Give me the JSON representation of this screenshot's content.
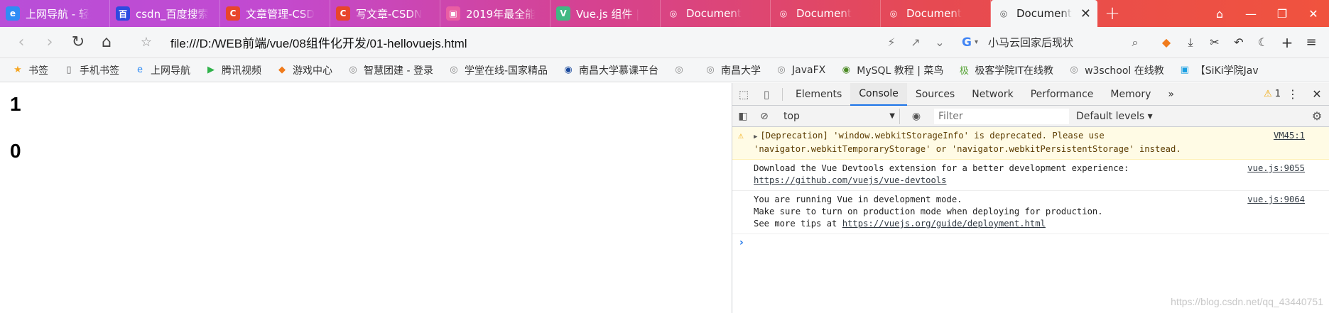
{
  "tabs": [
    {
      "title": "上网导航 - 轻",
      "icon": "e",
      "color": "#2f8cf5"
    },
    {
      "title": "csdn_百度搜索",
      "icon": "百",
      "color": "#2e4ae0"
    },
    {
      "title": "文章管理-CSD",
      "icon": "C",
      "color": "#e8452c"
    },
    {
      "title": "写文章-CSDN",
      "icon": "C",
      "color": "#e8452c"
    },
    {
      "title": "2019年最全能",
      "icon": "▣",
      "color": "#e95ea3"
    },
    {
      "title": "Vue.js 组件 |",
      "icon": "V",
      "color": "#41b883"
    },
    {
      "title": "Document",
      "icon": "◎",
      "color": "transparent"
    },
    {
      "title": "Document",
      "icon": "◎",
      "color": "transparent"
    },
    {
      "title": "Document",
      "icon": "◎",
      "color": "transparent"
    }
  ],
  "active_tab": {
    "title": "Document",
    "icon": "◎",
    "close": "✕"
  },
  "new_tab": "+",
  "window_controls": [
    "⌂",
    "—",
    "❐",
    "✕"
  ],
  "address": {
    "url": "file:///D:/WEB前端/vue/08组件化开发/01-hellovuejs.html",
    "search_text": "小马云回家后现状",
    "search_engine": "G"
  },
  "bookmarks": [
    {
      "label": "书签",
      "icon": "★",
      "color": "#f5a623"
    },
    {
      "label": "手机书签",
      "icon": "▯",
      "color": "#666"
    },
    {
      "label": "上网导航",
      "icon": "e",
      "color": "#2f8cf5"
    },
    {
      "label": "腾讯视频",
      "icon": "▶",
      "color": "#2fb24a"
    },
    {
      "label": "游戏中心",
      "icon": "◆",
      "color": "#f07b1c"
    },
    {
      "label": "智慧团建 - 登录",
      "icon": "◎",
      "color": "#888"
    },
    {
      "label": "学堂在线-国家精品",
      "icon": "◎",
      "color": "#888"
    },
    {
      "label": "南昌大学慕课平台",
      "icon": "◉",
      "color": "#1a4a9e"
    },
    {
      "label": "",
      "icon": "◎",
      "color": "#888"
    },
    {
      "label": "南昌大学",
      "icon": "◎",
      "color": "#888"
    },
    {
      "label": "JavaFX",
      "icon": "◎",
      "color": "#888"
    },
    {
      "label": "MySQL 教程 | 菜鸟",
      "icon": "◉",
      "color": "#4b8a24"
    },
    {
      "label": "极客学院IT在线教",
      "icon": "极",
      "color": "#56a335"
    },
    {
      "label": "w3school 在线教",
      "icon": "◎",
      "color": "#888"
    },
    {
      "label": "【SiKi学院Jav",
      "icon": "▣",
      "color": "#1ba0e2"
    }
  ],
  "page": {
    "line1": "1",
    "line2": "0"
  },
  "devtools": {
    "tabs": [
      "Elements",
      "Console",
      "Sources",
      "Network",
      "Performance",
      "Memory"
    ],
    "active": "Console",
    "more": "»",
    "warning_count": "1",
    "context": "top",
    "filter_placeholder": "Filter",
    "levels": "Default levels ▾",
    "messages": [
      {
        "type": "warning",
        "lines": [
          "[Deprecation] 'window.webkitStorageInfo' is deprecated. Please use",
          "'navigator.webkitTemporaryStorage' or 'navigator.webkitPersistentStorage' instead."
        ],
        "source": "VM45:1"
      },
      {
        "type": "info",
        "lines": [
          "Download the Vue Devtools extension for a better development experience:"
        ],
        "link": "https://github.com/vuejs/vue-devtools",
        "source": "vue.js:9055"
      },
      {
        "type": "info",
        "lines": [
          "You are running Vue in development mode.",
          "Make sure to turn on production mode when deploying for production."
        ],
        "prefix": "See more tips at ",
        "link": "https://vuejs.org/guide/deployment.html",
        "source": "vue.js:9064"
      }
    ],
    "prompt": "›"
  },
  "watermark": "https://blog.csdn.net/qq_43440751"
}
